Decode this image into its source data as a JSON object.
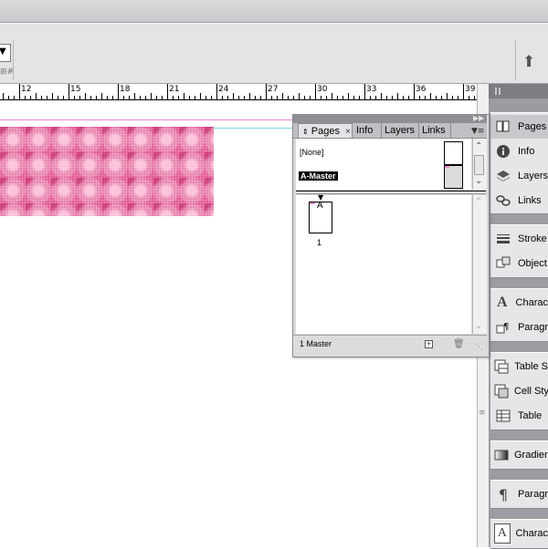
{
  "control_bar": {
    "dropdown_arrow": "⌄",
    "grid_glyph": "⊠⁠#",
    "lightning_icon": "lightning-bolt"
  },
  "ruler": {
    "labels": [
      "12",
      "15",
      "18",
      "21",
      "24",
      "27",
      "30",
      "33",
      "36",
      "39"
    ]
  },
  "pages_panel": {
    "tabs": [
      "Pages",
      "Info",
      "Layers",
      "Links"
    ],
    "masters": [
      {
        "label": "[None]"
      },
      {
        "label": "A-Master"
      }
    ],
    "page_prefix": "A",
    "page_number": "1",
    "footer": "1 Master"
  },
  "dock": {
    "items": [
      "Pages",
      "Info",
      "Layers",
      "Links",
      "Stroke",
      "Object",
      "Charac",
      "Paragr",
      "Table S",
      "Cell Sty",
      "Table",
      "Gradien",
      "Paragr",
      "Charac"
    ]
  },
  "colors": {
    "pattern": "#e25c95",
    "margin_magenta": "#e98bd0",
    "margin_cyan": "#7fd8e0"
  }
}
